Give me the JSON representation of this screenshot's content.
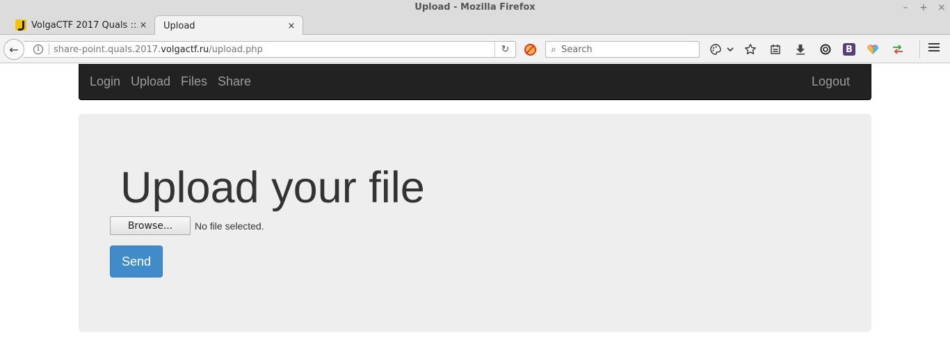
{
  "window": {
    "title": "Upload - Mozilla Firefox",
    "controls": [
      "–",
      "+",
      "×"
    ]
  },
  "tabs": [
    {
      "title": "VolgaCTF 2017 Quals ::...",
      "close": "×",
      "active": false
    },
    {
      "title": "Upload",
      "close": "×",
      "active": true
    }
  ],
  "new_tab_label": "+",
  "navbar": {
    "url_prefix": "share-point.quals.2017.",
    "url_domain": "volgactf.ru",
    "url_path": "/upload.php",
    "search_placeholder": "Search",
    "info_glyph": "i",
    "back_glyph": "←",
    "reload_glyph": "↻",
    "search_glyph": "⌕",
    "bootstrap_label": "B"
  },
  "site_nav": {
    "links": [
      "Login",
      "Upload",
      "Files",
      "Share"
    ],
    "logout": "Logout"
  },
  "main": {
    "heading": "Upload your file",
    "browse_label": "Browse...",
    "file_status": "No file selected.",
    "send_label": "Send"
  },
  "colors": {
    "navbar_bg": "#222222",
    "nav_link": "#9d9d9d",
    "jumbotron_bg": "#eeeeee",
    "send_button": "#428bca"
  }
}
